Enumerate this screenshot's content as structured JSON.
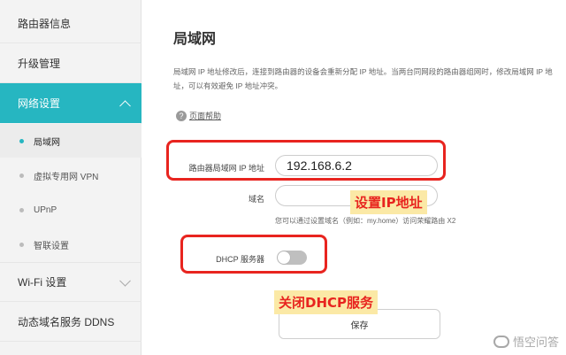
{
  "sidebar": {
    "items": [
      {
        "label": "路由器信息"
      },
      {
        "label": "升级管理"
      },
      {
        "label": "网络设置"
      },
      {
        "label": "Wi-Fi 设置"
      },
      {
        "label": "动态域名服务 DDNS"
      }
    ],
    "sub_items": [
      {
        "label": "局域网"
      },
      {
        "label": "虚拟专用网 VPN"
      },
      {
        "label": "UPnP"
      },
      {
        "label": "智联设置"
      }
    ]
  },
  "main": {
    "title": "局域网",
    "description": "局域网 IP 地址修改后，连接到路由器的设备会重新分配 IP 地址。当两台同网段的路由器组网时，修改局域网 IP 地址，可以有效避免 IP 地址冲突。",
    "help_label": "页面帮助",
    "help_icon_glyph": "?",
    "ip_label": "路由器局域网 IP 地址",
    "ip_value": "192.168.6.2",
    "domain_label": "域名",
    "domain_value": "",
    "domain_hint": "您可以通过设置域名（例如：my.home）访问荣耀路由 X2",
    "dhcp_label": "DHCP 服务器",
    "dhcp_enabled": false,
    "save_label": "保存"
  },
  "annotations": {
    "ip_callout": "设置IP地址",
    "dhcp_callout": "关闭DHCP服务",
    "color": "#e8241f"
  },
  "watermark": {
    "text": "悟空问答"
  },
  "colors": {
    "accent": "#26b6c1",
    "annotation_red": "#e8241f",
    "callout_bg": "#fbe9a6"
  }
}
